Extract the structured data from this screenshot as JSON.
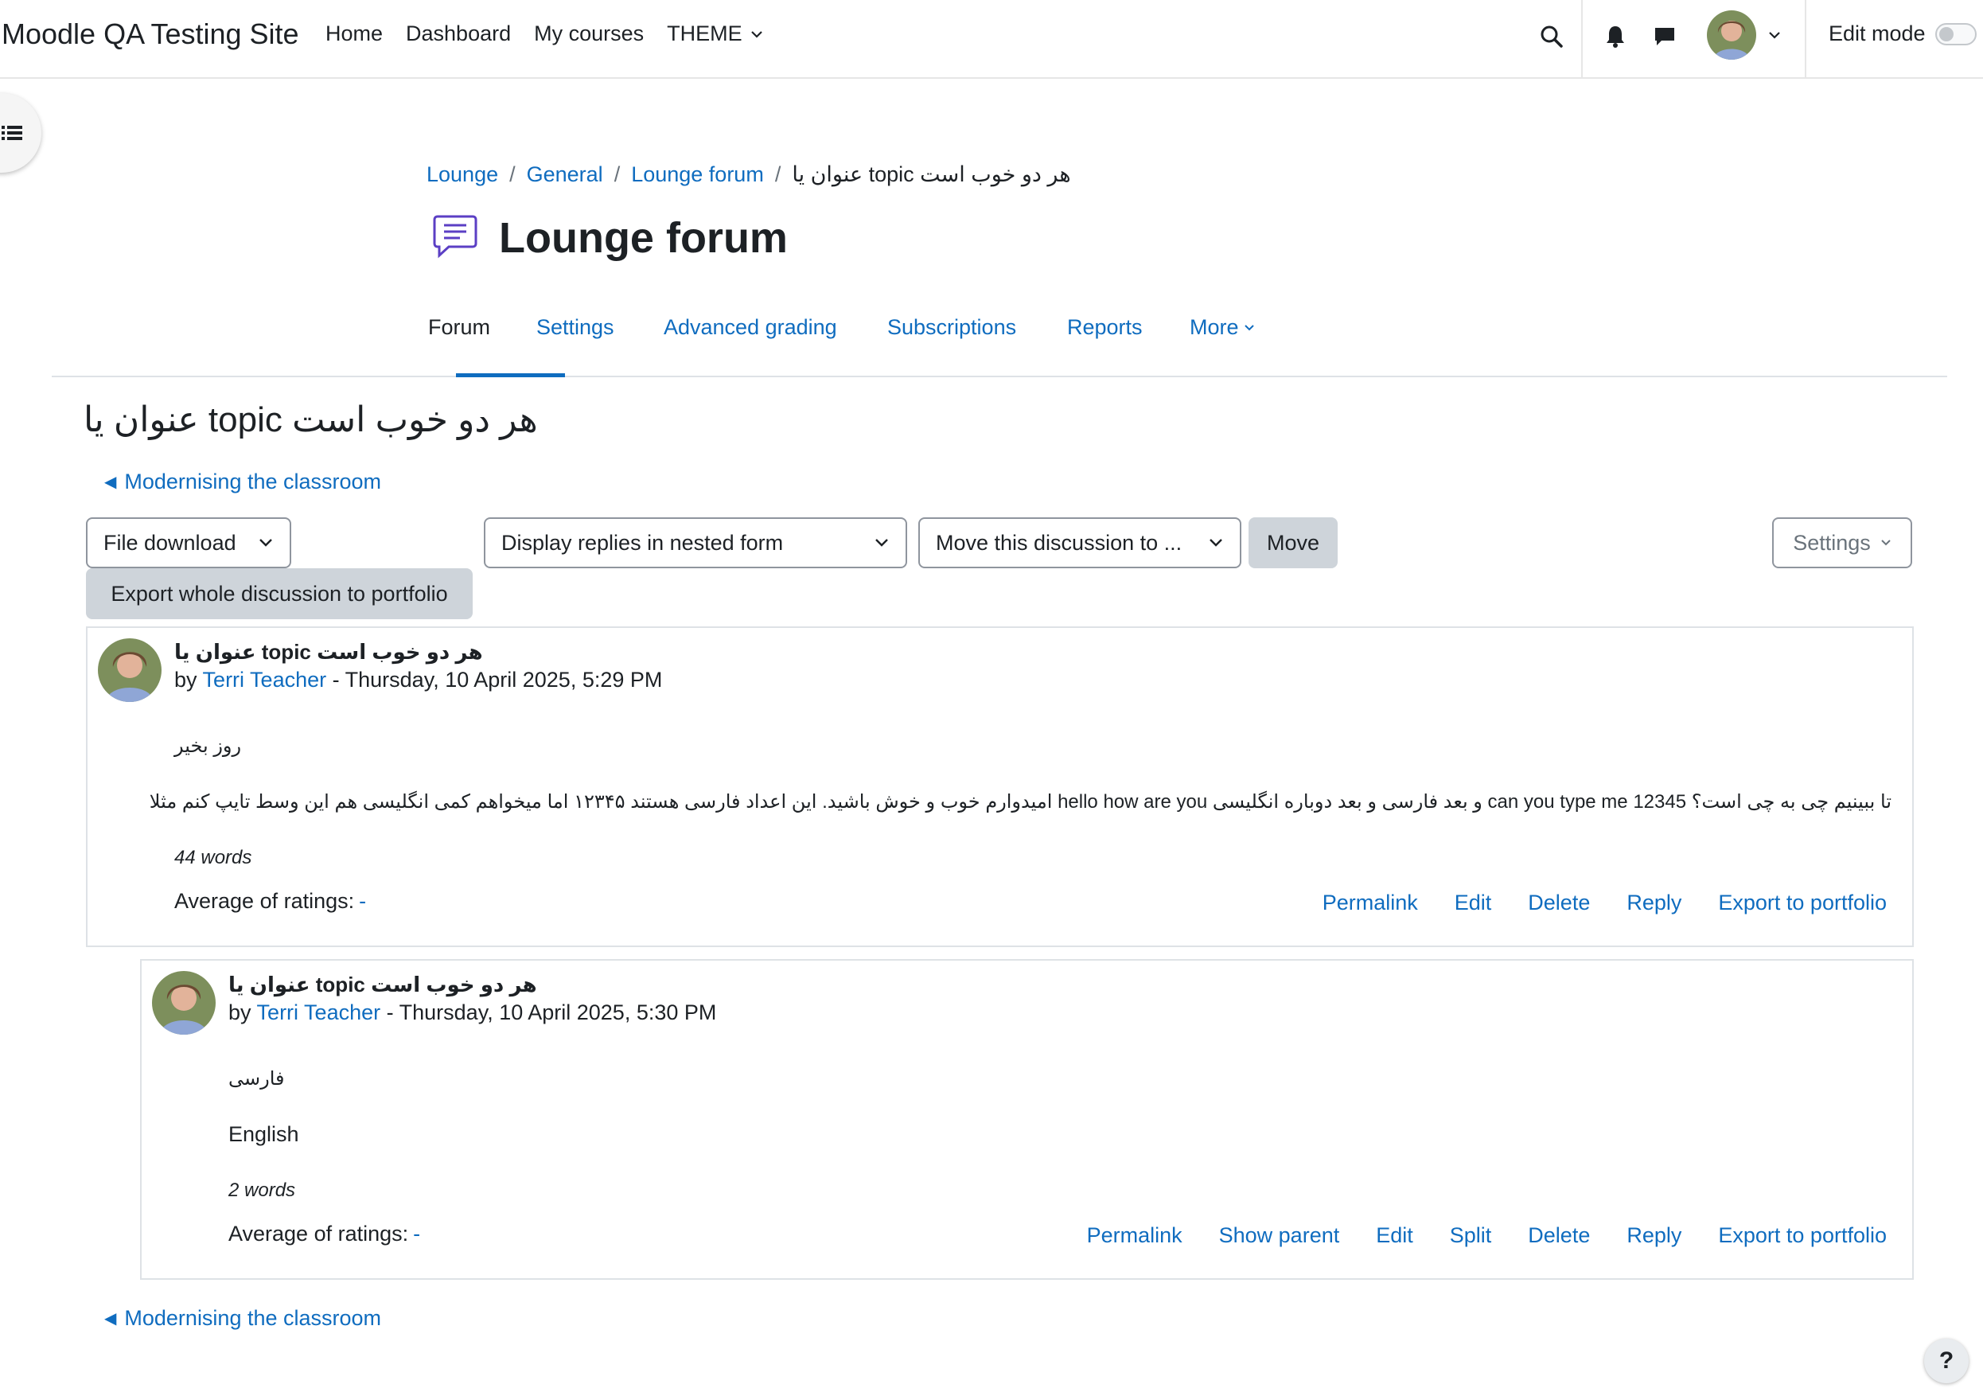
{
  "site_name": "Moodle QA Testing Site",
  "primary_nav": [
    "Home",
    "Dashboard",
    "My courses",
    "THEME"
  ],
  "edit_mode_label": "Edit mode",
  "breadcrumb": [
    "Lounge",
    "General",
    "Lounge forum",
    "هر دو خوب است topic عنوان یا"
  ],
  "page_title": "Lounge forum",
  "secondary_tabs": [
    "Forum",
    "Settings",
    "Advanced grading",
    "Subscriptions",
    "Reports",
    "More"
  ],
  "active_tab": "Forum",
  "discussion_title": "هر دو خوب است topic عنوان یا",
  "prev_discussion": "Modernising the classroom",
  "controls": {
    "file_download": "File download",
    "display_mode": "Display replies in nested form",
    "move_discussion": "Move this discussion to ...",
    "move_button": "Move",
    "settings_button": "Settings",
    "export_button": "Export whole discussion to portfolio"
  },
  "posts": [
    {
      "subject": "هر دو خوب است topic عنوان یا",
      "by_prefix": "by",
      "author": "Terri Teacher",
      "date": "- Thursday, 10 April 2025, 5:29 PM",
      "paragraphs": [
        "روز بخیر",
        "تا ببینیم چی به چی است؟ can you type me 12345 و بعد فارسی و بعد دوباره انگلیسی hello how are you امیدوارم خوب و خوش باشید. این اعداد فارسی هستند ۱۲۳۴۵ اما میخواهم کمی انگلیسی هم این وسط تایپ کنم مثلا"
      ],
      "word_count": "44 words",
      "ratings_label": "Average of ratings:",
      "ratings_value": "-",
      "actions": [
        "Permalink",
        "Edit",
        "Delete",
        "Reply",
        "Export to portfolio"
      ]
    },
    {
      "subject": "هر دو خوب است topic عنوان یا",
      "by_prefix": "by",
      "author": "Terri Teacher",
      "date": "- Thursday, 10 April 2025, 5:30 PM",
      "paragraphs": [
        "فارسی",
        "English"
      ],
      "word_count": "2 words",
      "ratings_label": "Average of ratings:",
      "ratings_value": "-",
      "actions": [
        "Permalink",
        "Show parent",
        "Edit",
        "Split",
        "Delete",
        "Reply",
        "Export to portfolio"
      ]
    }
  ],
  "help_label": "?",
  "colors": {
    "link": "#0f6cbf",
    "text": "#1d2125",
    "border": "#dee2e6",
    "forum_icon": "#5b3fc4"
  },
  "icons": [
    "search-icon",
    "bell-icon",
    "chat-icon",
    "chevron-down-icon",
    "drawer-index-icon",
    "forum-icon",
    "triangle-left-icon",
    "help-icon"
  ]
}
